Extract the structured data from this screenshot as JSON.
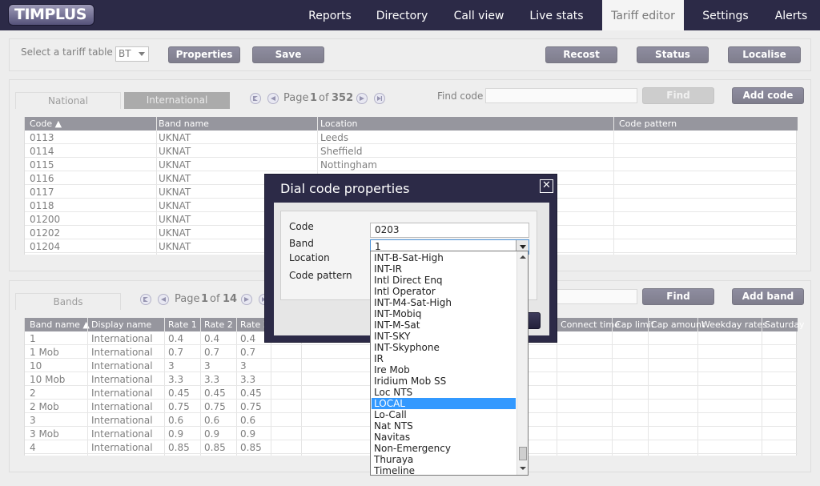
{
  "app": {
    "logo": "TIMPLUS"
  },
  "nav": [
    "Reports",
    "Directory",
    "Call view",
    "Live stats",
    "Tariff editor",
    "Settings",
    "Alerts"
  ],
  "toolbar": {
    "select_label": "Select a tariff table",
    "table_value": "BT",
    "properties": "Properties",
    "save": "Save",
    "recost": "Recost",
    "status": "Status",
    "localise": "Localise"
  },
  "codes": {
    "tabs": [
      "National",
      "International"
    ],
    "page_label": "Page",
    "page": "1",
    "of_label": "of",
    "page_total": "352",
    "find_label": "Find code",
    "find_button": "Find",
    "add_button": "Add code",
    "columns": [
      "Code ▲",
      "Band name",
      "Location",
      "Code pattern"
    ],
    "rows": [
      [
        "0113",
        "UKNAT",
        "Leeds",
        ""
      ],
      [
        "0114",
        "UKNAT",
        "Sheffield",
        ""
      ],
      [
        "0115",
        "UKNAT",
        "Nottingham",
        ""
      ],
      [
        "0116",
        "UKNAT",
        "",
        ""
      ],
      [
        "0117",
        "UKNAT",
        "",
        ""
      ],
      [
        "0118",
        "UKNAT",
        "",
        ""
      ],
      [
        "01200",
        "UKNAT",
        "",
        ""
      ],
      [
        "01202",
        "UKNAT",
        "",
        ""
      ],
      [
        "01204",
        "UKNAT",
        "",
        ""
      ]
    ]
  },
  "bands": {
    "tab": "Bands",
    "page_label": "Page",
    "page": "1",
    "of_label": "of",
    "page_total": "14",
    "find_button": "Find",
    "add_button": "Add band",
    "columns": [
      "Band name ▲",
      "Display name",
      "Rate 1",
      "Rate 2",
      "Rate 3",
      "Connect time",
      "Cap limit",
      "Cap amount",
      "Weekday rates",
      "Saturday"
    ],
    "rows": [
      [
        "1",
        "International",
        "0.4",
        "0.4",
        "0.4"
      ],
      [
        "1 Mob",
        "International",
        "0.7",
        "0.7",
        "0.7"
      ],
      [
        "10",
        "International",
        "3",
        "3",
        "3"
      ],
      [
        "10 Mob",
        "International",
        "3.3",
        "3.3",
        "3.3"
      ],
      [
        "2",
        "International",
        "0.45",
        "0.45",
        "0.45"
      ],
      [
        "2 Mob",
        "International",
        "0.75",
        "0.75",
        "0.75"
      ],
      [
        "3",
        "International",
        "0.6",
        "0.6",
        "0.6"
      ],
      [
        "3 Mob",
        "International",
        "0.9",
        "0.9",
        "0.9"
      ],
      [
        "4",
        "International",
        "0.85",
        "0.85",
        "0.85"
      ]
    ]
  },
  "dialog": {
    "title": "Dial code properties",
    "close_icon": "close-icon",
    "code_label": "Code",
    "code_value": "0203",
    "band_label": "Band",
    "band_value": "1",
    "location_label": "Location",
    "pattern_label": "Code pattern",
    "dropdown_options": [
      "INT-B-Sat-High",
      "INT-IR",
      "Intl Direct Enq",
      "Intl Operator",
      "INT-M4-Sat-High",
      "INT-Mobiq",
      "INT-M-Sat",
      "INT-SKY",
      "INT-Skyphone",
      "IR",
      "Ire Mob",
      "Iridium Mob SS",
      "Loc NTS",
      "LOCAL",
      "Lo-Call",
      "Nat NTS",
      "Navitas",
      "Non-Emergency",
      "Thuraya",
      "Timeline"
    ],
    "selected_option": "LOCAL"
  },
  "colors": {
    "nav_bg": "#2c2a47",
    "button_bg": "#2c2a47",
    "selection": "#3399ff",
    "header_bg": "#4a4a58"
  }
}
